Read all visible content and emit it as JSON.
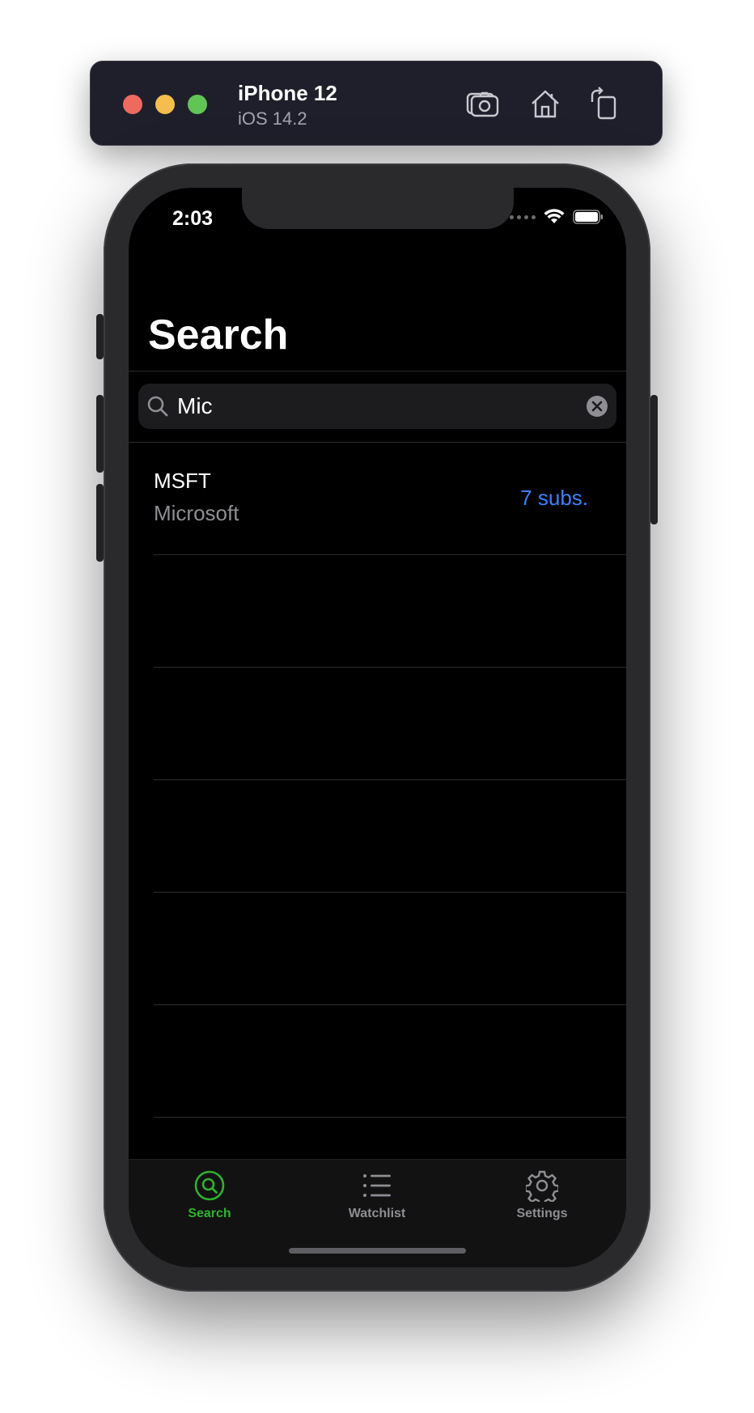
{
  "simulator": {
    "device_name": "iPhone 12",
    "os_version": "iOS 14.2",
    "toolbar_icons": [
      "screenshot-icon",
      "home-icon",
      "rotate-icon"
    ]
  },
  "status_bar": {
    "time": "2:03"
  },
  "nav": {
    "title": "Search"
  },
  "search": {
    "value": "Mic"
  },
  "results": [
    {
      "symbol": "MSFT",
      "name": "Microsoft",
      "subscriptions": "7 subs."
    }
  ],
  "tabs": [
    {
      "label": "Search",
      "icon": "search-icon",
      "active": true
    },
    {
      "label": "Watchlist",
      "icon": "list-icon",
      "active": false
    },
    {
      "label": "Settings",
      "icon": "gear-icon",
      "active": false
    }
  ],
  "colors": {
    "accent_active": "#30b030",
    "inactive_tab": "#8e8e93",
    "link_blue": "#3b82f6",
    "background": "#000000"
  }
}
